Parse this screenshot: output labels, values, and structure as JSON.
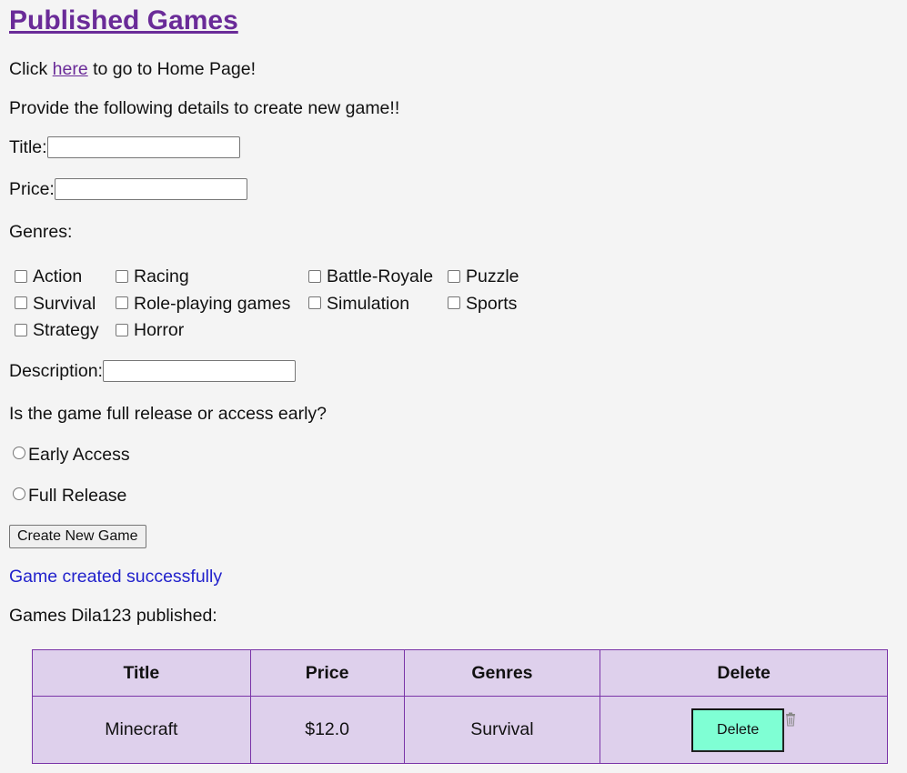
{
  "page": {
    "heading": "Published Games",
    "home_prefix": "Click ",
    "home_link": "here",
    "home_suffix": " to go to Home Page!",
    "instructions": "Provide the following details to create new game!!"
  },
  "form": {
    "title_label": "Title:",
    "title_value": "",
    "price_label": "Price:",
    "price_value": "",
    "genres_label": "Genres:",
    "genres": [
      {
        "label": "Action",
        "checked": false
      },
      {
        "label": "Racing",
        "checked": false
      },
      {
        "label": "Battle-Royale",
        "checked": false
      },
      {
        "label": "Puzzle",
        "checked": false
      },
      {
        "label": "Survival",
        "checked": false
      },
      {
        "label": "Role-playing games",
        "checked": false
      },
      {
        "label": "Simulation",
        "checked": false
      },
      {
        "label": "Sports",
        "checked": false
      },
      {
        "label": "Strategy",
        "checked": false
      },
      {
        "label": "Horror",
        "checked": false
      }
    ],
    "description_label": "Description:",
    "description_value": "",
    "release_question": "Is the game full release or access early?",
    "release_options": [
      {
        "label": "Early Access",
        "selected": false
      },
      {
        "label": "Full Release",
        "selected": false
      }
    ],
    "submit_label": "Create New Game"
  },
  "status": {
    "message": "Game created successfully",
    "message_color": "#2222cc"
  },
  "published": {
    "caption": "Games Dila123 published:",
    "columns": [
      "Title",
      "Price",
      "Genres",
      "Delete"
    ],
    "rows": [
      {
        "title": "Minecraft",
        "price": "$12.0",
        "genres": "Survival",
        "delete_label": "Delete",
        "icon": "trash-icon"
      }
    ]
  },
  "colors": {
    "heading": "#6a2b98",
    "table_bg": "#ded0ec",
    "table_border": "#7a35a8",
    "delete_button": "#7fffd4",
    "page_bg": "#f4f4f4"
  }
}
